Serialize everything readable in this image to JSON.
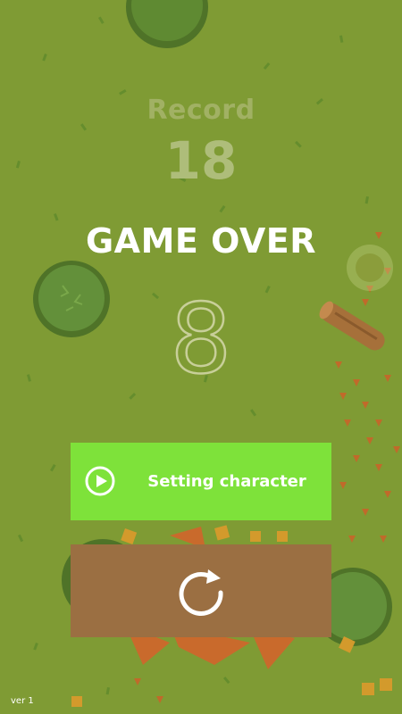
{
  "record": {
    "label": "Record",
    "value": "18"
  },
  "game_over": {
    "title": "GAME OVER",
    "score": "8"
  },
  "buttons": {
    "setting_character": {
      "label": "Setting character",
      "icon": "play-circle-icon"
    },
    "retry": {
      "icon": "restart-icon"
    }
  },
  "footer": {
    "version": "ver 1"
  },
  "colors": {
    "background": "#7f9b34",
    "setting_button": "#7ee23a",
    "retry_button": "#9b6f42",
    "bush": "#5b7f2c",
    "log": "#a6703a",
    "leaf": "#c96a2c"
  }
}
